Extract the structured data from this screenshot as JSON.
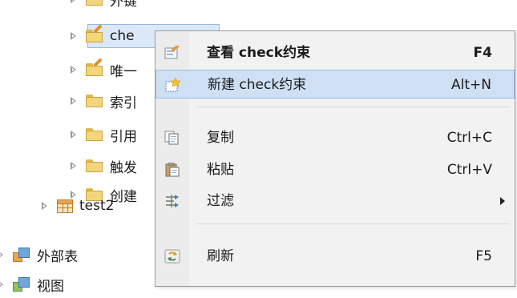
{
  "tree": {
    "items": [
      {
        "label": "外键"
      },
      {
        "label": "che"
      },
      {
        "label": "唯一"
      },
      {
        "label": "索引"
      },
      {
        "label": "引用"
      },
      {
        "label": "触发"
      },
      {
        "label": "创建"
      },
      {
        "label": "test2"
      },
      {
        "label": "外部表"
      },
      {
        "label": "视图"
      }
    ]
  },
  "menu": {
    "items": [
      {
        "label": "查看 check约束",
        "shortcut": "F4",
        "icon": "view-check-icon"
      },
      {
        "label": "新建 check约束",
        "shortcut": "Alt+N",
        "icon": "new-check-icon"
      },
      {
        "label": "复制",
        "shortcut": "Ctrl+C",
        "icon": "copy-icon"
      },
      {
        "label": "粘贴",
        "shortcut": "Ctrl+V",
        "icon": "paste-icon"
      },
      {
        "label": "过滤",
        "shortcut": "",
        "icon": "filter-icon"
      },
      {
        "label": "刷新",
        "shortcut": "F5",
        "icon": "refresh-icon"
      }
    ]
  },
  "colors": {
    "highlight": "#cfe0f5",
    "menu_bg": "#f2f2f2",
    "selection": "#dbe8f7"
  }
}
